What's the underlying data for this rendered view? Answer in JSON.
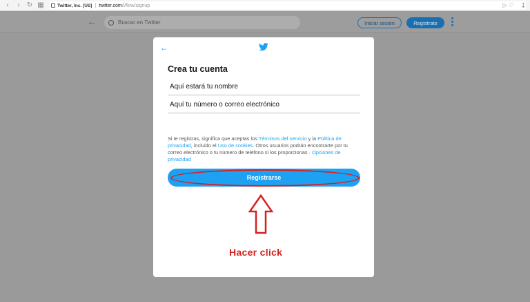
{
  "browser": {
    "site_badge": "Twitter, Inc. [US]",
    "url_domain": "twitter.com",
    "url_path": "/i/flow/signup",
    "icons": [
      "back-icon",
      "forward-icon",
      "reload-icon",
      "apps-icon",
      "lock-icon",
      "send-icon",
      "heart-icon",
      "download-icon"
    ]
  },
  "header": {
    "search_placeholder": "Buscar en Twitter",
    "login_label": "Iniciar sesión",
    "signup_label": "Regístrate"
  },
  "modal": {
    "title": "Crea tu cuenta",
    "name_placeholder": "Aquí estará tu nombre",
    "contact_placeholder": "Aquí tu número o correo electrónico",
    "legal": {
      "t1": "Si te registras, significa que aceptas los ",
      "link_terms": "Términos del servicio",
      "t2": " y la ",
      "link_privacy": "Política de privacidad",
      "t3": ", incluido el ",
      "link_cookies": "Uso de cookies",
      "t4": ". Otros usuarios podrán encontrarte por tu correo electrónico o tu número de teléfono si los proporcionas · ",
      "link_options": "Opciones de privacidad"
    },
    "submit_label": "Registrarse"
  },
  "annotation": {
    "text": "Hacer click",
    "color": "#d62020"
  },
  "colors": {
    "twitter_blue": "#1da1f2",
    "overlay": "#9a9a9a"
  }
}
